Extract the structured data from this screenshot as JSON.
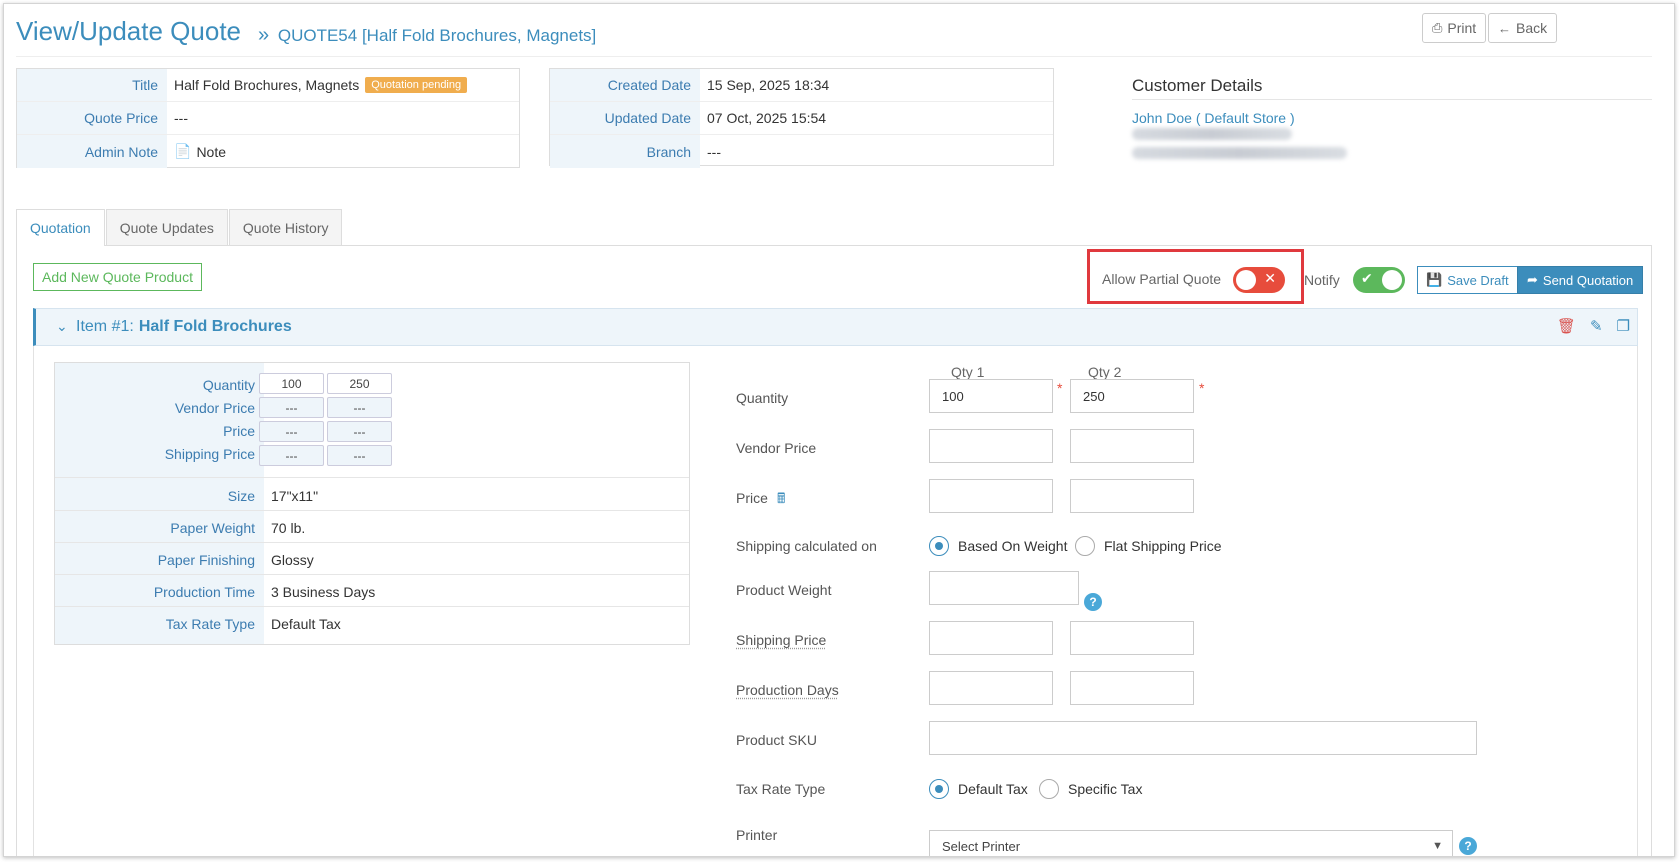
{
  "header": {
    "title": "View/Update Quote",
    "breadcrumb_arrows": "»",
    "breadcrumb": "QUOTE54 [Half Fold Brochures, Magnets]",
    "print_label": "Print",
    "back_label": "Back"
  },
  "quote_info": {
    "title_label": "Title",
    "title_value": "Half Fold Brochures, Magnets",
    "status_badge": "Quotation pending",
    "price_label": "Quote Price",
    "price_value": "---",
    "note_label": "Admin Note",
    "note_value": "Note"
  },
  "dates": {
    "created_label": "Created Date",
    "created_value": "15 Sep, 2025 18:34",
    "updated_label": "Updated Date",
    "updated_value": "07 Oct, 2025 15:54",
    "branch_label": "Branch",
    "branch_value": "---"
  },
  "customer": {
    "heading": "Customer Details",
    "name": "John Doe ( Default Store )"
  },
  "tabs": [
    {
      "label": "Quotation"
    },
    {
      "label": "Quote Updates"
    },
    {
      "label": "Quote History"
    }
  ],
  "toolbar": {
    "add_product": "Add New Quote Product",
    "allow_partial_label": "Allow Partial Quote",
    "allow_partial_state": "off",
    "notify_label": "Notify",
    "notify_state": "on",
    "save_draft": "Save Draft",
    "send_quotation": "Send Quotation"
  },
  "item": {
    "number_label": "Item #1:",
    "name": "Half Fold Brochures"
  },
  "spec": {
    "quantity_label": "Quantity",
    "vendor_price_label": "Vendor Price",
    "price_label": "Price",
    "shipping_price_label": "Shipping Price",
    "qty_values": [
      "100",
      "250"
    ],
    "placeholder": "---",
    "rows": [
      {
        "label": "Size",
        "value": "17\"x11\""
      },
      {
        "label": "Paper Weight",
        "value": "70 lb."
      },
      {
        "label": "Paper Finishing",
        "value": "Glossy"
      },
      {
        "label": "Production Time",
        "value": "3 Business Days"
      },
      {
        "label": "Tax Rate Type",
        "value": "Default Tax"
      }
    ]
  },
  "form": {
    "qty1_header": "Qty 1",
    "qty2_header": "Qty 2",
    "quantity_label": "Quantity",
    "qty1_value": "100",
    "qty2_value": "250",
    "required_mark": "*",
    "vendor_price_label": "Vendor Price",
    "price_label": "Price",
    "shipping_calc_label": "Shipping calculated on",
    "ship_opt_weight": "Based On Weight",
    "ship_opt_flat": "Flat Shipping Price",
    "product_weight_label": "Product Weight",
    "shipping_price_label": "Shipping Price",
    "production_days_label": "Production Days",
    "product_sku_label": "Product SKU",
    "tax_rate_label": "Tax Rate Type",
    "tax_opt_default": "Default Tax",
    "tax_opt_specific": "Specific Tax",
    "printer_label": "Printer",
    "printer_select": "Select Printer",
    "help_mark": "?"
  },
  "colors": {
    "accent": "#3c8dbc",
    "badge": "#f0ad4e",
    "toggle_off": "#e74c3c",
    "toggle_on": "#5cb85c",
    "highlight": "#e0393e"
  }
}
